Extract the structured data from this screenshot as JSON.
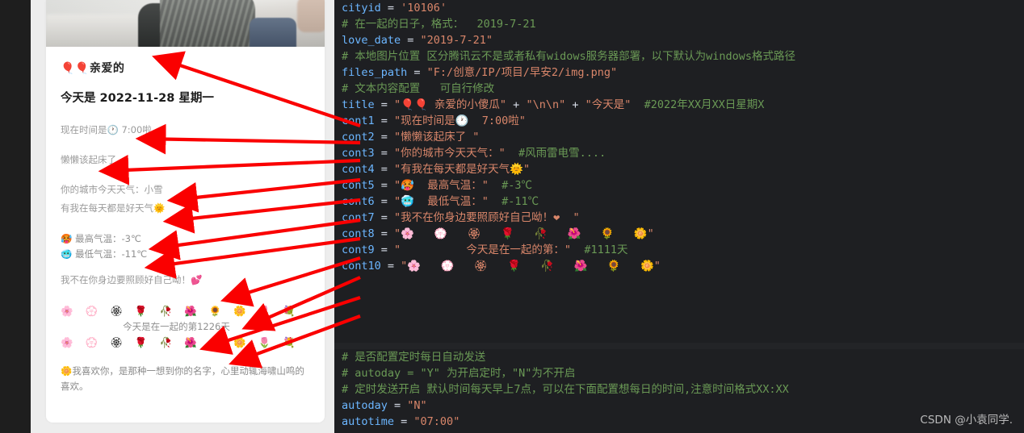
{
  "preview": {
    "photo_alt": "snowy-outdoor-photo",
    "title": "🎈🎈亲爱的",
    "date_line": "今天是 2022-11-28 星期一",
    "line_time": "现在时间是🕐 7:00啦",
    "line_wake": "懒懒该起床了",
    "line_weather": "你的城市今天天气：小雪",
    "line_goodweather": "有我在每天都是好天气🌞",
    "line_hightemp": "🥵 最高气温：-3℃",
    "line_lowtemp": "🥶 最低气温：-11℃",
    "line_care": "我不在你身边要照顾好自己呦！💕",
    "flowers_top": "🌸 💮 🏵 🌹 🥀 🌺 🌻 🌼 🌷 💐",
    "days_line": "今天是在一起的第1226天",
    "flowers_bottom": "🌸 💮 🏵 🌹 🥀 🌺 🌻 🌼 🌷 💐",
    "quote": "🌼我喜欢你，是那种一想到你的名字，心里动辄海啸山鸣的喜欢。"
  },
  "code": {
    "top_partial_comment": "#   ",
    "lines": [
      {
        "var": "cityid",
        "op": " = ",
        "str": "'10106'",
        "comment": ""
      },
      {
        "comment": "# 在一起的日子，格式：  2019-7-21"
      },
      {
        "var": "love_date",
        "op": " = ",
        "str": "\"2019-7-21\"",
        "comment": ""
      },
      {
        "comment": "# 本地图片位置 区分腾讯云不是或者私有widows服务器部署，以下默认为windows格式路径"
      },
      {
        "var": "files_path",
        "op": " = ",
        "str": "\"F:/创意/IP/项目/早安2/img.png\"",
        "comment": ""
      },
      {
        "comment": "# 文本内容配置   可自行修改"
      },
      {
        "var": "title",
        "op": " = ",
        "str": "\"🎈🎈 亲爱的小傻瓜\"",
        "op2": " + ",
        "str2": "\"\\n\\n\"",
        "op3": " + ",
        "str3": "\"今天是\"",
        "comment": "#2022年XX月XX日星期X"
      },
      {
        "var": "cont1",
        "op": " = ",
        "str": "\"现在时间是🕐  7:00啦\"",
        "comment": ""
      },
      {
        "var": "cont2",
        "op": " = ",
        "str": "\"懒懒该起床了 \"",
        "comment": ""
      },
      {
        "var": "cont3",
        "op": " = ",
        "str": "\"你的城市今天天气：\"",
        "comment": "#风雨雷电雪...."
      },
      {
        "var": "cont4",
        "op": " = ",
        "str": "\"有我在每天都是好天气🌞\"",
        "comment": ""
      },
      {
        "var": "cont5",
        "op": " = ",
        "str": "\"🥵  最高气温：\"",
        "comment": "#-3℃"
      },
      {
        "var": "cont6",
        "op": " = ",
        "str": "\"🥶  最低气温：\"",
        "comment": "#-11℃"
      },
      {
        "var": "cont7",
        "op": " = ",
        "str": "\"我不在你身边要照顾好自己呦！❤  \"",
        "comment": ""
      },
      {
        "var": "cont8",
        "op": " = ",
        "str": "\"🌸   💮   🏵   🌹   🥀   🌺   🌻   🌼\"",
        "comment": ""
      },
      {
        "var": "cont9",
        "op": " = ",
        "str": "\"          今天是在一起的第：\"",
        "comment": "#1111天"
      },
      {
        "var": "cont10",
        "op": " = ",
        "str": "\"🌸   💮   🏵   🌹   🥀   🌺   🌻   🌼\"",
        "comment": ""
      }
    ],
    "block2": [
      {
        "comment": "# 是否配置定时每日自动发送"
      },
      {
        "comment": "# autoday = \"Y\" 为开启定时，\"N\"为不开启"
      },
      {
        "comment": "# 定时发送开启 默认时间每天早上7点，可以在下面配置想每日的时间,注意时间格式XX:XX"
      },
      {
        "var": "autoday",
        "op": " = ",
        "str": "\"N\"",
        "comment": ""
      },
      {
        "var": "autotime",
        "op": " = ",
        "str": "\"07:00\"",
        "comment": ""
      }
    ]
  },
  "watermark": "CSDN @小袁同学.",
  "colors": {
    "code_bg": "#1e1f22",
    "variable": "#6cb6ff",
    "string": "#d9866a",
    "comment": "#6a9955",
    "arrow": "#ff0000",
    "preview_bg": "#ededed"
  }
}
